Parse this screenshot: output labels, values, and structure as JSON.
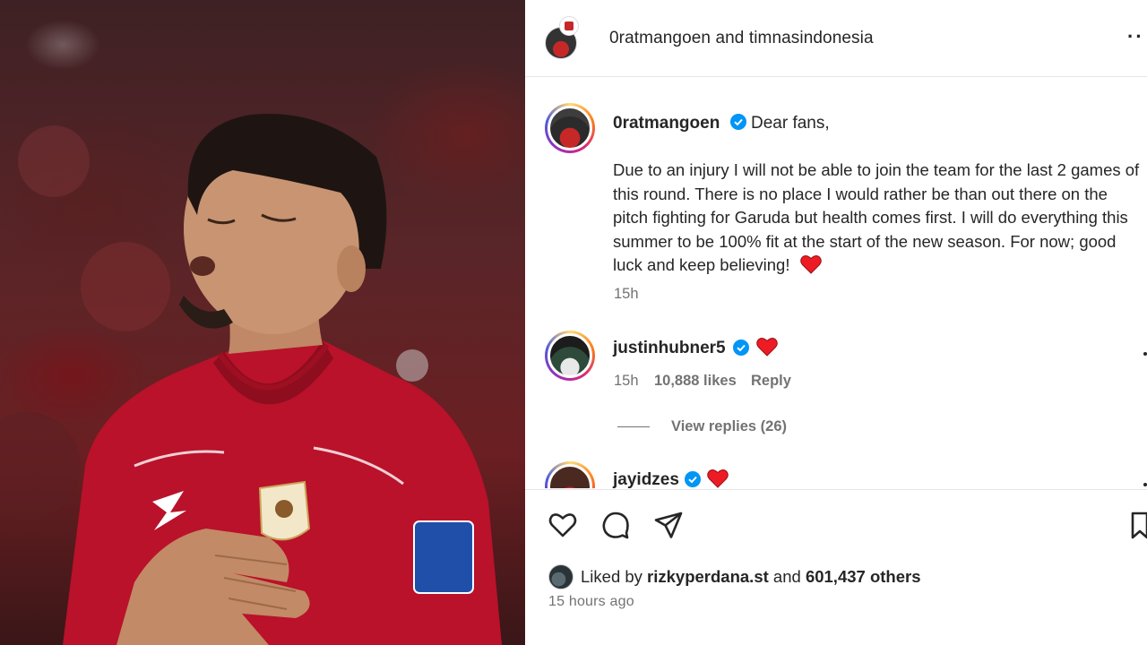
{
  "header": {
    "title": "0ratmangoen and timnasindonesia",
    "more_icon": "more-horizontal-icon"
  },
  "caption": {
    "username": "0ratmangoen",
    "first_line": "Dear fans,",
    "body": "Due to an injury I will not be able to join the team for the last 2 games of this round. There is no place I would rather be than out there on the pitch fighting for Garuda but health comes first. I will do everything this summer to be 100% fit at the start of the new season. For now; good luck and keep believing!",
    "time": "15h"
  },
  "comments": [
    {
      "username": "justinhubner5",
      "time": "15h",
      "likes": "10,888 likes",
      "reply_label": "Reply",
      "view_replies": "View replies (26)"
    },
    {
      "username": "jayidzes"
    }
  ],
  "actions": {
    "like_icon": "heart-outline-icon",
    "comment_icon": "comment-icon",
    "share_icon": "send-icon",
    "save_icon": "bookmark-icon"
  },
  "likes_summary": {
    "prefix": "Liked by",
    "user": "rizkyperdana.st",
    "conjunction": "and",
    "count": "601,437 others"
  },
  "posted": "15 hours ago",
  "colors": {
    "verified": "#0095f6",
    "heart": "#ed1c24",
    "jersey": "#c8102e"
  }
}
